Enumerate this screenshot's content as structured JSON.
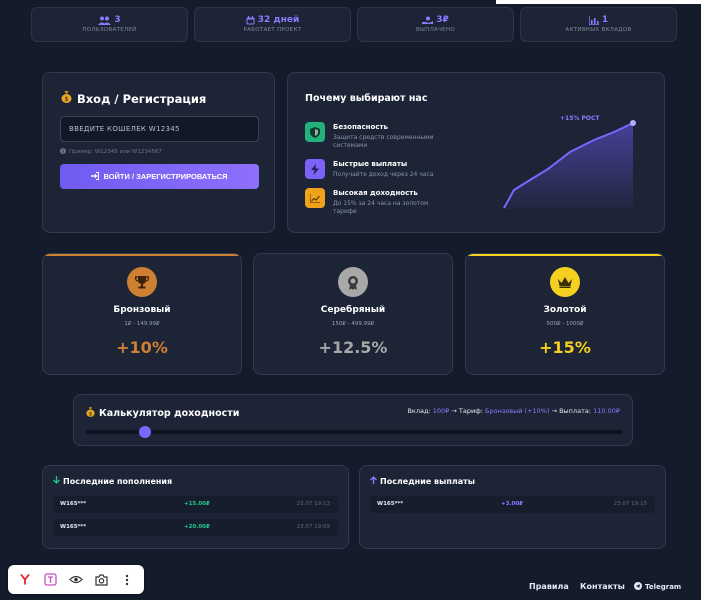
{
  "stats": [
    {
      "icon": "users-icon",
      "value": "3",
      "label": "ПОЛЬЗОВАТЕЛЕЙ"
    },
    {
      "icon": "calendar-icon",
      "value": "32 дней",
      "label": "РАБОТАЕТ ПРОЕКТ"
    },
    {
      "icon": "hand-coin-icon",
      "value": "3₽",
      "label": "ВЫПЛАЧЕНО"
    },
    {
      "icon": "chart-icon",
      "value": "1",
      "label": "АКТИВНЫХ ВКЛАДОВ"
    }
  ],
  "login": {
    "title": "Вход / Регистрация",
    "input_placeholder": "ВВЕДИТЕ КОШЕЛЕК W12345",
    "hint": "Пример: W12345 или W1234567",
    "button": "ВОЙТИ / ЗАРЕГИСТРИРОВАТЬСЯ"
  },
  "why": {
    "title": "Почему выбирают нас",
    "features": [
      {
        "title": "Безопасность",
        "desc": "Защита средств современными системами",
        "color": "#22b07d"
      },
      {
        "title": "Быстрые выплаты",
        "desc": "Получайте доход через 24 часа",
        "color": "#7a63f6"
      },
      {
        "title": "Высокая доходность",
        "desc": "До 15% за 24 часа на золотом тарифе",
        "color": "#f0a21b"
      }
    ],
    "chart_label": "+15% РОСТ"
  },
  "tiers": [
    {
      "name": "Бронзовый",
      "range": "1₽ - 149.99₽",
      "percent": "+10%",
      "color": "#cd7f32"
    },
    {
      "name": "Серебряный",
      "range": "150₽ - 499.99₽",
      "percent": "+12.5%",
      "color": "#a8a8a8"
    },
    {
      "name": "Золотой",
      "range": "500₽ - 1000₽",
      "percent": "+15%",
      "color": "#f5d020"
    }
  ],
  "calculator": {
    "title": "Калькулятор доходности",
    "deposit_label": "Вклад:",
    "deposit_value": "100₽",
    "tariff_label": "→ Тариф:",
    "tariff_value": "Бронзовый (+10%)",
    "payout_label": "→ Выплата:",
    "payout_value": "110.00₽",
    "slider_level": 0.11
  },
  "deposits": {
    "title": "Последние пополнения",
    "rows": [
      {
        "wallet": "W165***",
        "amount": "+15.00₽",
        "date": "23.07 19:13"
      },
      {
        "wallet": "W165***",
        "amount": "+20.00₽",
        "date": "23.07 19:09"
      }
    ]
  },
  "withdrawals": {
    "title": "Последние выплаты",
    "rows": [
      {
        "wallet": "W165***",
        "amount": "+3.00₽",
        "date": "23.07 19:15"
      }
    ]
  },
  "footer": {
    "rules": "Правила",
    "contacts": "Контакты",
    "telegram": "Telegram"
  },
  "colors": {
    "accent": "#8b7bff",
    "background": "#141b2b",
    "card": "#1c2436",
    "green": "#22c98a"
  }
}
